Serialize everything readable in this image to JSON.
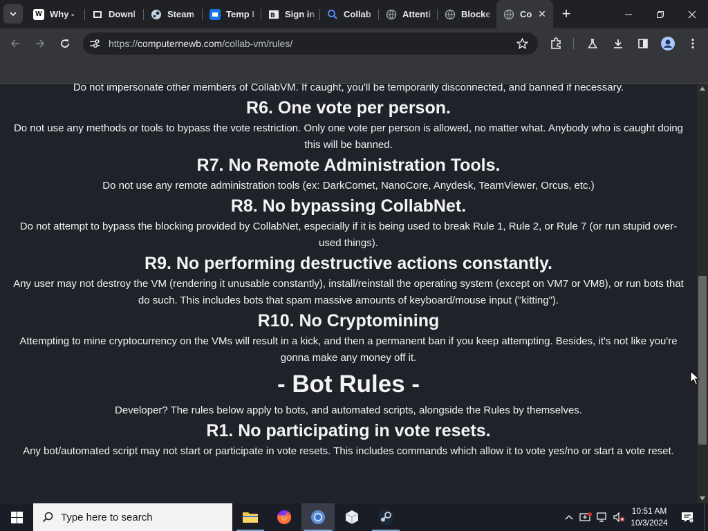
{
  "browser": {
    "tabs": [
      {
        "title": "Why -",
        "favicon": "W",
        "favicon_color": "#ffffff",
        "favicon_bg": "#ffffff"
      },
      {
        "title": "Downl",
        "favicon": "download-page",
        "favicon_color": "#e8eaed"
      },
      {
        "title": "Steam",
        "favicon": "steam",
        "favicon_color": "#c7d5e0"
      },
      {
        "title": "Temp I",
        "favicon": "temp-mail",
        "favicon_color": "#1a73e8"
      },
      {
        "title": "Sign in",
        "favicon": "signin-site",
        "favicon_color": "#e8eaed"
      },
      {
        "title": "Collab",
        "favicon": "search",
        "favicon_color": "#4c8bf5"
      },
      {
        "title": "Attenti",
        "favicon": "globe",
        "favicon_color": "#9aa0a6"
      },
      {
        "title": "Blocke",
        "favicon": "globe",
        "favicon_color": "#9aa0a6"
      },
      {
        "title": "Co",
        "favicon": "globe",
        "favicon_color": "#9aa0a6",
        "active": true
      }
    ],
    "url_scheme": "https://",
    "url_host": "computernewb.com",
    "url_path": "/collab-vm/rules/"
  },
  "content": {
    "line_top": "Do not impersonate other members of CollabVM. If caught, you'll be temporarily disconnected, and banned if necessary.",
    "r6_title": "R6. One vote per person.",
    "r6_text": "Do not use any methods or tools to bypass the vote restriction. Only one vote per person is allowed, no matter what. Anybody who is caught doing this will be banned.",
    "r7_title": "R7. No Remote Administration Tools.",
    "r7_text": "Do not use any remote administration tools (ex: DarkComet, NanoCore, Anydesk, TeamViewer, Orcus, etc.)",
    "r8_title": "R8. No bypassing CollabNet.",
    "r8_text": "Do not attempt to bypass the blocking provided by CollabNet, especially if it is being used to break Rule 1, Rule 2, or Rule 7 (or run stupid over-used things).",
    "r9_title": "R9. No performing destructive actions constantly.",
    "r9_text": "Any user may not destroy the VM (rendering it unusable constantly), install/reinstall the operating system (except on VM7 or VM8), or run bots that do such. This includes bots that spam massive amounts of keyboard/mouse input (\"kitting\").",
    "r10_title": "R10. No Cryptomining",
    "r10_text": "Attempting to mine cryptocurrency on the VMs will result in a kick, and then a permanent ban if you keep attempting. Besides, it's not like you're gonna make any money off it.",
    "bot_rules_title": "- Bot Rules -",
    "bot_rules_text": "Developer? The rules below apply to bots, and automated scripts, alongside the Rules by themselves.",
    "b1_title": "R1. No participating in vote resets.",
    "b1_text": "Any bot/automated script may not start or participate in vote resets. This includes commands which allow it to vote yes/no or start a vote reset."
  },
  "taskbar": {
    "search_placeholder": "Type here to search",
    "time": "10:51 AM",
    "date": "10/3/2024"
  },
  "colors": {
    "page_bg": "#1f2329",
    "browser_frame": "#202124",
    "toolbar": "#35363a"
  }
}
